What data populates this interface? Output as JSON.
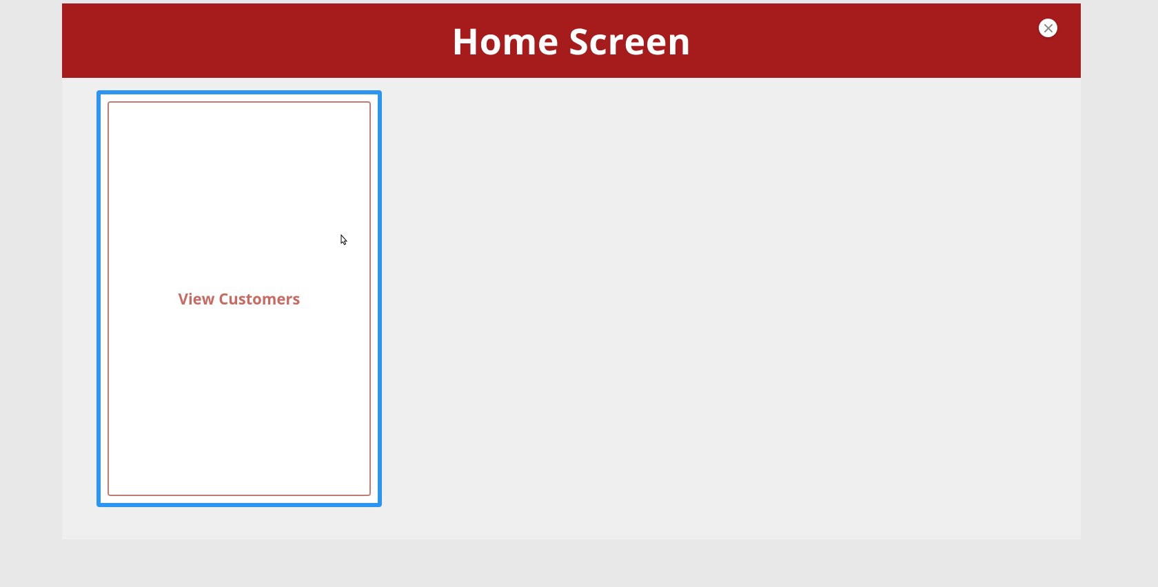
{
  "header": {
    "title": "Home Screen"
  },
  "cards": [
    {
      "label": "View Customers"
    }
  ],
  "colors": {
    "header_bg": "#a61b1b",
    "card_border": "#2c94f1",
    "card_inner_border": "#c47973",
    "card_text": "#c76a62",
    "page_bg": "#efefef"
  }
}
